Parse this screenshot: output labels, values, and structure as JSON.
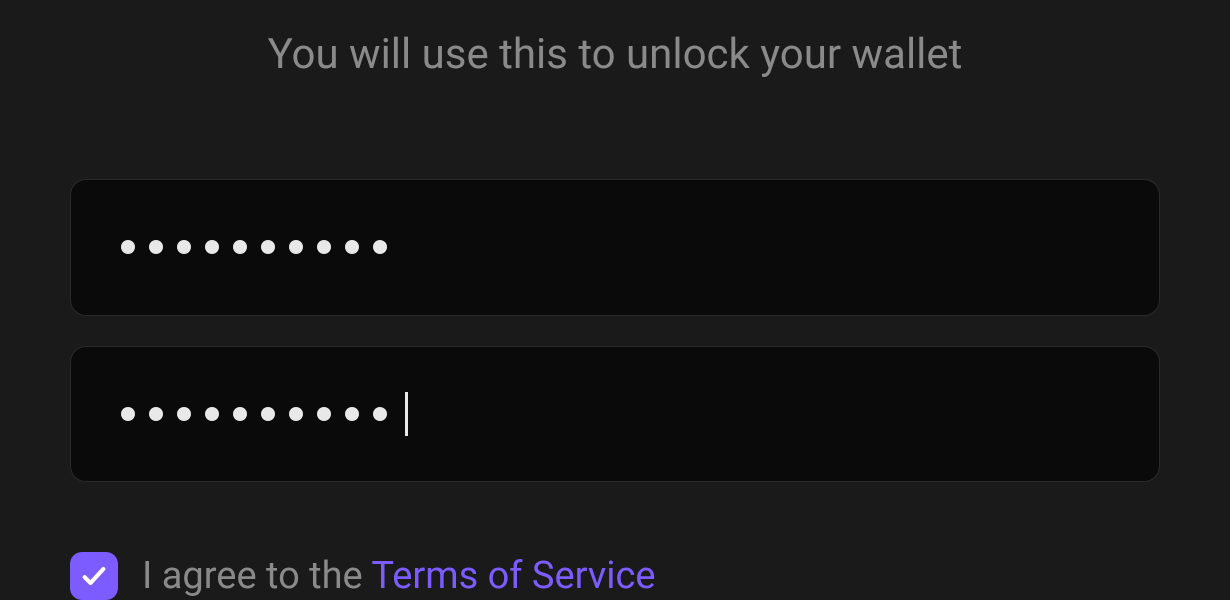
{
  "subtitle": "You will use this to unlock your wallet",
  "password": {
    "dotCount": 10,
    "hasCursor": false
  },
  "confirmPassword": {
    "dotCount": 10,
    "hasCursor": true
  },
  "terms": {
    "checked": true,
    "prefix": "I agree to the ",
    "linkText": "Terms of Service"
  },
  "colors": {
    "accent": "#7c5cff"
  }
}
